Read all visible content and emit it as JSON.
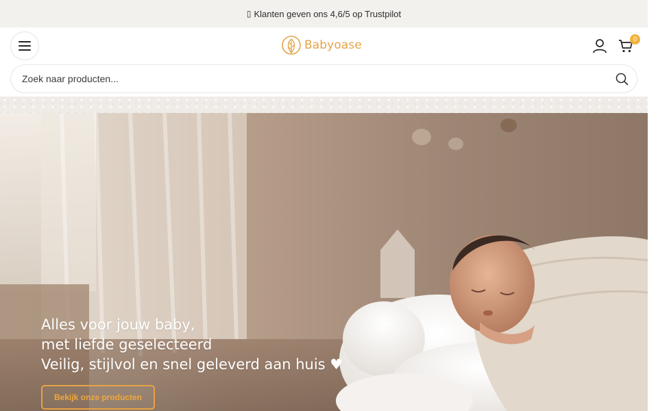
{
  "announcement": {
    "icon": "star-icon",
    "text": "Klanten geven ons 4,6/5 op Trustpilot"
  },
  "header": {
    "menu_icon": "hamburger-menu-icon",
    "logo_text": "Babyoase",
    "user_icon": "user-icon",
    "cart_icon": "shopping-cart-icon",
    "cart_count": "0"
  },
  "search": {
    "placeholder": "Zoek naar producten...",
    "value": "",
    "icon": "search-icon"
  },
  "hero": {
    "line1": "Alles voor jouw baby,",
    "line2": "met liefde geselecteerd",
    "line3": "Veilig, stijlvol en snel geleverd aan huis ♥",
    "cta_label": "Bekijk onze producten"
  },
  "colors": {
    "accent": "#E8A344",
    "badge": "#F2B33D",
    "topbar_bg": "#F3F1EE"
  }
}
